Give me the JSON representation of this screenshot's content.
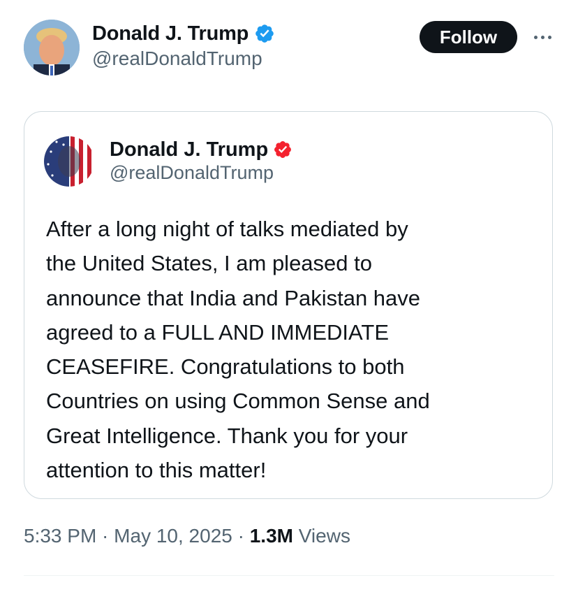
{
  "author": {
    "display_name": "Donald J. Trump",
    "handle": "@realDonaldTrump",
    "verified_icon": "verified-badge-icon",
    "verified_color": "#1d9bf0"
  },
  "actions": {
    "follow_label": "Follow",
    "more_icon": "more-horizontal-icon"
  },
  "quoted_post": {
    "display_name": "Donald J. Trump",
    "handle": "@realDonaldTrump",
    "verified_icon": "verified-badge-icon",
    "verified_color": "#f4212e",
    "body": "After a long night of talks mediated by\nthe United States, I am pleased to\nannounce that India and Pakistan have\nagreed to a FULL AND IMMEDIATE\nCEASEFIRE. Congratulations to both\nCountries on using Common Sense and\nGreat Intelligence. Thank you for your\nattention to this matter!"
  },
  "meta": {
    "time": "5:33 PM",
    "separator": " · ",
    "date": "May 10, 2025",
    "views_count": "1.3M",
    "views_label": "Views"
  }
}
